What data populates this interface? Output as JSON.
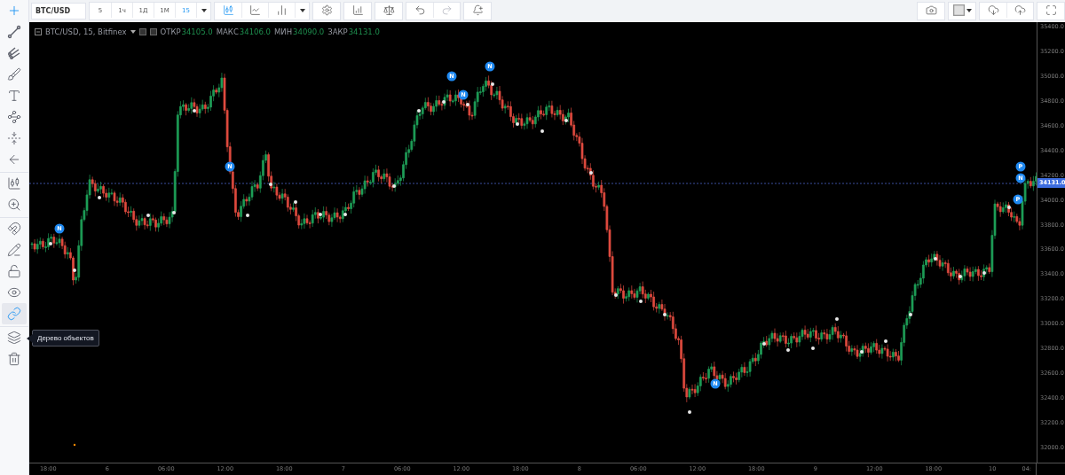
{
  "sidebar": {
    "groups": [
      [
        {
          "kind": "crosshair",
          "selected": true
        },
        {
          "kind": "trend-line",
          "selected": false
        },
        {
          "kind": "pitchfork",
          "selected": false
        },
        {
          "kind": "brush",
          "selected": false
        },
        {
          "kind": "text",
          "selected": false
        },
        {
          "kind": "pattern",
          "selected": false
        },
        {
          "kind": "projection",
          "selected": false
        },
        {
          "kind": "back",
          "selected": false
        }
      ],
      [
        {
          "kind": "candle-zoom"
        },
        {
          "kind": "zoom-in"
        }
      ],
      [
        {
          "kind": "magnet",
          "on": false
        },
        {
          "kind": "lock-drawing",
          "on": false
        },
        {
          "kind": "lock",
          "on": false
        },
        {
          "kind": "eye",
          "on": false
        },
        {
          "kind": "link",
          "on": true
        }
      ],
      [
        {
          "kind": "layers",
          "tooltip": "Дерево объектов"
        },
        {
          "kind": "trash"
        }
      ]
    ]
  },
  "toolbar": {
    "symbol": "BTC/USD",
    "intervals": [
      {
        "label": "5",
        "selected": false
      },
      {
        "label": "1ч",
        "selected": false
      },
      {
        "label": "1Д",
        "selected": false
      },
      {
        "label": "1М",
        "selected": false
      },
      {
        "label": "15",
        "selected": true
      }
    ],
    "left_groups": [
      [
        {
          "kind": "candles",
          "selected": true
        },
        {
          "kind": "line",
          "selected": false
        },
        {
          "kind": "bars",
          "selected": false
        }
      ],
      [
        {
          "kind": "settings"
        }
      ],
      [
        {
          "kind": "indicators"
        }
      ],
      [
        {
          "kind": "compare"
        }
      ],
      [
        {
          "kind": "undo",
          "disabled": false
        },
        {
          "kind": "redo",
          "disabled": true
        }
      ],
      [
        {
          "kind": "alert"
        }
      ]
    ],
    "right_groups": [
      [
        {
          "kind": "camera"
        }
      ],
      [
        {
          "kind": "color"
        }
      ],
      [
        {
          "kind": "cloud-download"
        },
        {
          "kind": "cloud-upload"
        }
      ],
      [
        {
          "kind": "fullscreen"
        }
      ]
    ]
  },
  "legend": {
    "title": "BTC/USD, 15, Bitfinex",
    "fields": [
      {
        "label": "ОТКР",
        "value": "34105.0"
      },
      {
        "label": "МАКС",
        "value": "34106.0"
      },
      {
        "label": "МИН",
        "value": "34090.0"
      },
      {
        "label": "ЗАКР",
        "value": "34131.0"
      }
    ]
  },
  "markers": [
    {
      "label": "N"
    },
    {
      "label": "N"
    },
    {
      "label": "N"
    },
    {
      "label": "N"
    },
    {
      "label": "N"
    },
    {
      "label": "N"
    },
    {
      "label": "P"
    },
    {
      "label": "N"
    },
    {
      "label": "P"
    }
  ],
  "price_axis": {
    "ticks": [
      "35400.0",
      "35200.0",
      "35000.0",
      "34800.0",
      "34600.0",
      "34400.0",
      "34200.0",
      "34000.0",
      "33800.0",
      "33600.0",
      "33400.0",
      "33200.0",
      "33000.0",
      "32800.0",
      "32600.0",
      "32400.0",
      "32200.0",
      "32000.0"
    ],
    "last_price": "34131.0"
  },
  "time_axis": {
    "ticks": [
      "18:00",
      "6",
      "06:00",
      "12:00",
      "18:00",
      "7",
      "06:00",
      "12:00",
      "18:00",
      "8",
      "06:00",
      "12:00",
      "18:00",
      "9",
      "12:00",
      "18:00",
      "10",
      "04:"
    ]
  }
}
